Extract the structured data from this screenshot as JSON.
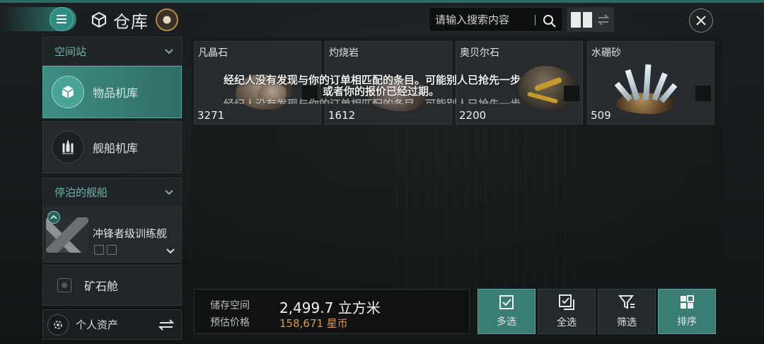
{
  "header": {
    "title": "仓库",
    "search_placeholder": "请输入搜索内容"
  },
  "sidebar": {
    "section_station": "空间站",
    "items": [
      {
        "label": "物品机库"
      },
      {
        "label": "舰船机库"
      }
    ],
    "section_docked": "停泊的舰船",
    "ship_name": "冲锋者级训练舰",
    "ore_hold": "矿石舱",
    "assets": "个人资产"
  },
  "grid": {
    "items": [
      {
        "name": "凡晶石",
        "qty": "3271"
      },
      {
        "name": "灼烧岩",
        "qty": "1612"
      },
      {
        "name": "奥贝尔石",
        "qty": "2200"
      },
      {
        "name": "水硼砂",
        "qty": "509"
      }
    ]
  },
  "notice": {
    "line1": "经纪人没有发现与你的订单相匹配的条目。可能别人已抢先一步",
    "line2": "或者你的报价已经过期。",
    "line3": "经纪人没有发现与你的订单相匹配的条目。可能别人已抢先一步"
  },
  "footer": {
    "storage_label": "储存空间",
    "storage_value": "2,499.7 立方米",
    "price_label": "预估价格",
    "price_value": "158,671 星币",
    "buttons": [
      "多选",
      "全选",
      "筛选",
      "排序"
    ]
  },
  "colors": {
    "accent": "#3a7d73",
    "price": "#d99b3d"
  }
}
